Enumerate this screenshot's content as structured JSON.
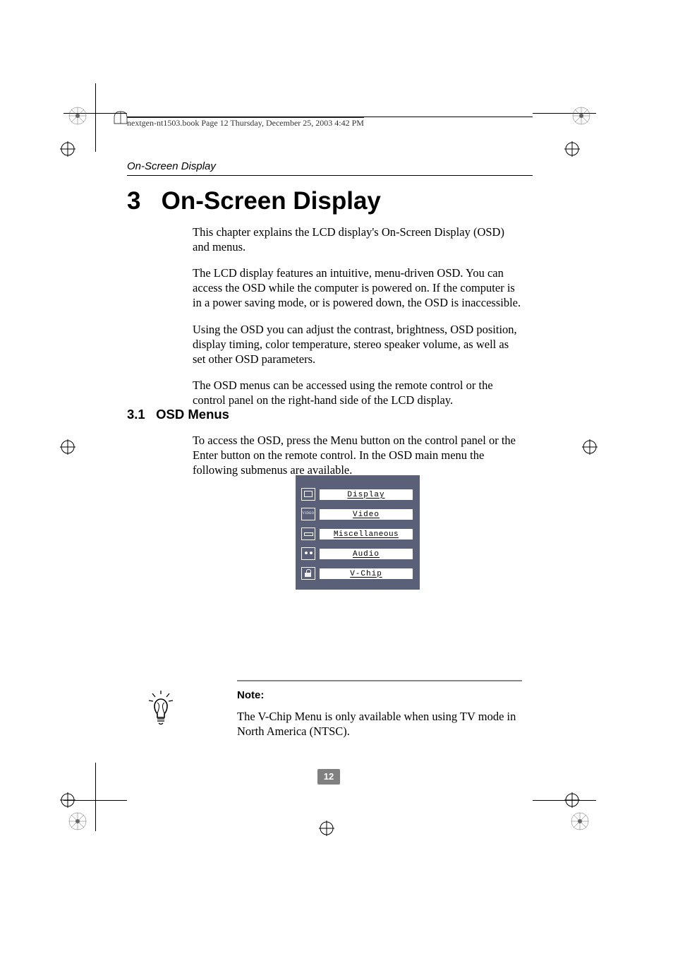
{
  "header": {
    "running_title": "On-Screen Display",
    "file_stamp": "nextgen-nt1503.book  Page 12  Thursday, December 25, 2003  4:42 PM"
  },
  "chapter": {
    "number": "3",
    "title": "On-Screen Display"
  },
  "paragraphs": {
    "p1": "This chapter explains the LCD display's On-Screen Display (OSD) and menus.",
    "p2": "The LCD display features an intuitive, menu-driven OSD. You can access the OSD while the computer is powered on. If the computer is in a power saving mode, or is powered down, the OSD is inaccessible.",
    "p3": "Using the OSD you can adjust the contrast, brightness, OSD position, display timing, color temperature, stereo speaker volume, as well as set other OSD parameters.",
    "p4": "The OSD menus can be accessed using the remote control or the control panel on the right-hand side of the LCD display."
  },
  "subsection": {
    "number": "3.1",
    "title": "OSD Menus",
    "intro": "To access the OSD, press the Menu button on the control panel or the Enter button on the remote control. In the OSD main menu the following submenus are available."
  },
  "osd_menu": {
    "items": [
      {
        "icon": "display-icon",
        "label": "Display"
      },
      {
        "icon": "video-icon",
        "label": "Video"
      },
      {
        "icon": "misc-icon",
        "label": "Miscellaneous"
      },
      {
        "icon": "audio-icon",
        "label": "Audio"
      },
      {
        "icon": "vchip-icon",
        "label": "V-Chip"
      }
    ]
  },
  "note": {
    "heading": "Note:",
    "body": "The V-Chip Menu is only available when using TV mode in North America (NTSC)."
  },
  "page_number": "12"
}
